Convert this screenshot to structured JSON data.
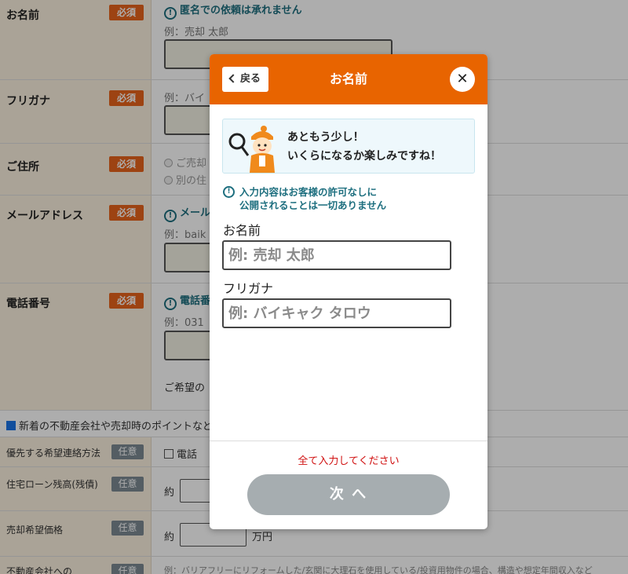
{
  "form": {
    "name_label": "お名前",
    "required": "必須",
    "optional": "任意",
    "name_note": "匿名での依頼は承れません",
    "name_example": "例：売却 太郎",
    "kana_label": "フリガナ",
    "kana_example": "例：バイ",
    "address_label": "ご住所",
    "address_opt1": "ご売却",
    "address_opt2": "別の住",
    "email_label": "メールアドレス",
    "email_note": "メール",
    "email_example": "例：baik",
    "phone_label": "電話番号",
    "phone_note": "電話番",
    "phone_example": "例：031",
    "wish_text": "ご希望の",
    "newsletter_text": "新着の不動産会社や売却時のポイントなど",
    "contact_method_label": "優先する希望連絡方法",
    "contact_method_opt": "電話",
    "loan_label": "住宅ローン残高(残債)",
    "loan_prefix": "約",
    "price_label": "売却希望価格",
    "price_prefix": "約",
    "price_unit": "万円",
    "company_label": "不動産会社への",
    "company_example": "例：バリアフリーにリフォームした/玄関に大理石を使用している/投資用物件の場合、構造や想定年間収入など"
  },
  "modal": {
    "back_label": "戻る",
    "title": "お名前",
    "close_symbol": "✕",
    "bubble_line1": "あともう少し！",
    "bubble_line2": "いくらになるか楽しみですね！",
    "privacy_line1": "入力内容はお客様の許可なしに",
    "privacy_line2": "公開されることは一切ありません",
    "name_label": "お名前",
    "name_placeholder": "例: 売却 太郎",
    "kana_label": "フリガナ",
    "kana_placeholder": "例: バイキャク タロウ",
    "warning": "全て入力してください",
    "next_label": "次 へ"
  },
  "colors": {
    "accent": "#e86400",
    "info": "#1e6f7f",
    "warning": "#d01010",
    "disabled_button": "#a6adb0"
  }
}
